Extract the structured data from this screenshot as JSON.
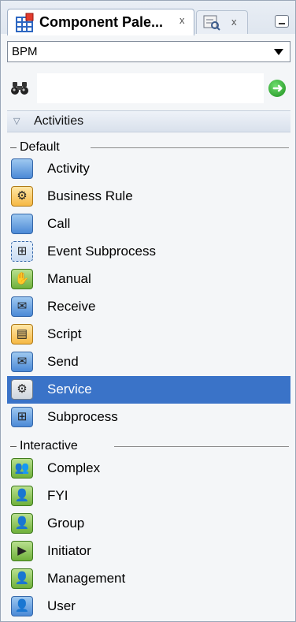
{
  "tabs": [
    {
      "label": "Component Pale...",
      "close": "x"
    },
    {
      "label": "",
      "close": "x"
    }
  ],
  "dropdown": {
    "value": "BPM"
  },
  "search": {
    "placeholder": "",
    "value": ""
  },
  "section": {
    "label": "Activities"
  },
  "groups": [
    {
      "label": "Default",
      "items": [
        {
          "label": "Activity",
          "icon": "activity-icon",
          "style": "blue",
          "glyph": ""
        },
        {
          "label": "Business Rule",
          "icon": "business-rule-icon",
          "style": "orange",
          "glyph": "⚙"
        },
        {
          "label": "Call",
          "icon": "call-icon",
          "style": "blue",
          "glyph": ""
        },
        {
          "label": "Event Subprocess",
          "icon": "event-subprocess-icon",
          "style": "dashed",
          "glyph": "⊞"
        },
        {
          "label": "Manual",
          "icon": "manual-icon",
          "style": "green",
          "glyph": "✋"
        },
        {
          "label": "Receive",
          "icon": "receive-icon",
          "style": "blue",
          "glyph": "✉"
        },
        {
          "label": "Script",
          "icon": "script-icon",
          "style": "orange",
          "glyph": "▤"
        },
        {
          "label": "Send",
          "icon": "send-icon",
          "style": "blue",
          "glyph": "✉"
        },
        {
          "label": "Service",
          "icon": "service-icon",
          "style": "grey",
          "glyph": "⚙",
          "selected": true
        },
        {
          "label": "Subprocess",
          "icon": "subprocess-icon",
          "style": "blue",
          "glyph": "⊞"
        }
      ]
    },
    {
      "label": "Interactive",
      "items": [
        {
          "label": "Complex",
          "icon": "complex-icon",
          "style": "green",
          "glyph": "👥"
        },
        {
          "label": "FYI",
          "icon": "fyi-icon",
          "style": "green",
          "glyph": "👤"
        },
        {
          "label": "Group",
          "icon": "group-icon",
          "style": "green",
          "glyph": "👤"
        },
        {
          "label": "Initiator",
          "icon": "initiator-icon",
          "style": "green",
          "glyph": "▶"
        },
        {
          "label": "Management",
          "icon": "management-icon",
          "style": "green",
          "glyph": "👤"
        },
        {
          "label": "User",
          "icon": "user-icon",
          "style": "blue",
          "glyph": "👤"
        }
      ]
    }
  ],
  "colors": {
    "selected_row": "#3a73c8",
    "frame_border": "#9aa7b8"
  }
}
